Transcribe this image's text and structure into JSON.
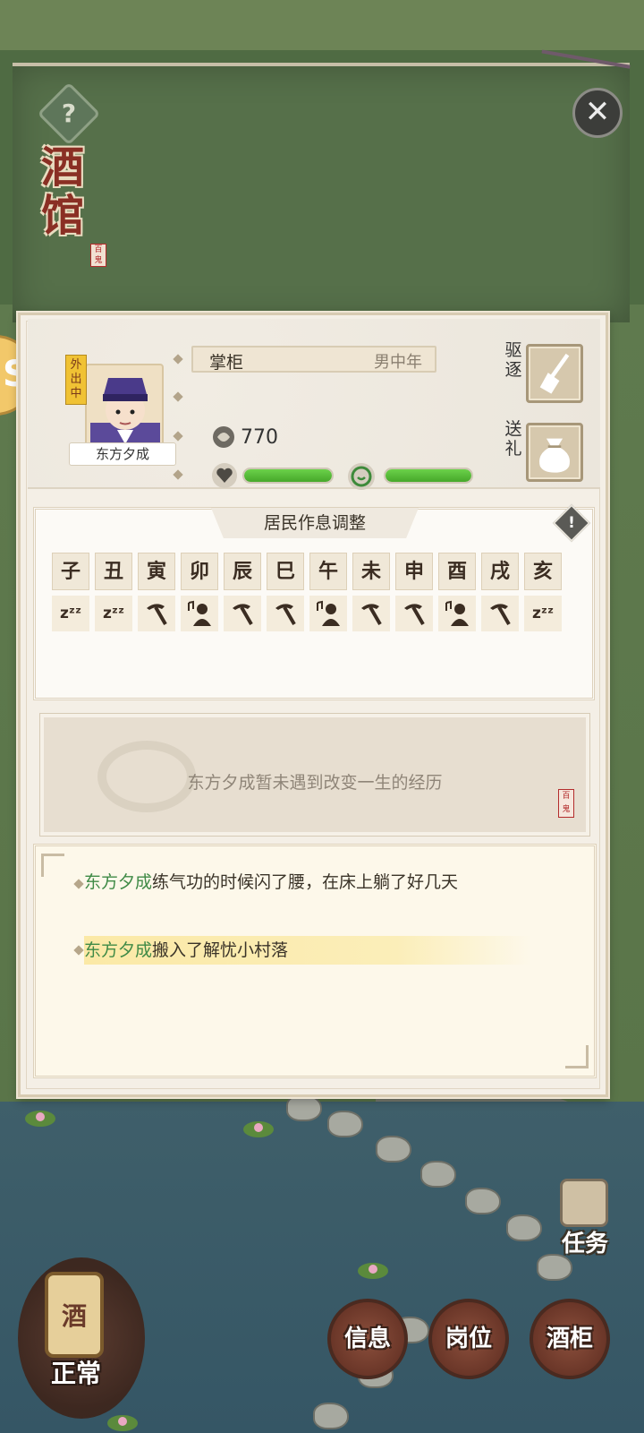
{
  "board": {
    "title": "酒馆",
    "seal": "百鬼",
    "help_icon": "?",
    "close_icon": "✕"
  },
  "resident": {
    "name": "东方夕成",
    "status_badge": "外出中",
    "role": "掌柜",
    "gender_age": "男中年",
    "coins": "770",
    "health_percent": 100,
    "mood_percent": 100
  },
  "actions": {
    "expel_label": "驱逐",
    "gift_label": "送礼"
  },
  "schedule": {
    "title": "居民作息调整",
    "info_icon": "!",
    "hours": [
      "子",
      "丑",
      "寅",
      "卯",
      "辰",
      "巳",
      "午",
      "未",
      "申",
      "酉",
      "戌",
      "亥"
    ],
    "activities": [
      "sleep",
      "sleep",
      "work",
      "leisure",
      "work",
      "work",
      "leisure",
      "work",
      "work",
      "leisure",
      "work",
      "sleep"
    ],
    "sleep_symbol": "zᶻᶻ"
  },
  "experience": {
    "text": "东方夕成暂未遇到改变一生的经历",
    "seal": "百鬼"
  },
  "log": [
    {
      "who": "东方夕成",
      "text": "练气功的时候闪了腰，在床上躺了好几天"
    },
    {
      "who": "东方夕成",
      "text": "搬入了解忧小村落"
    }
  ],
  "bottom": {
    "tasks_label": "任务",
    "info_label": "信息",
    "post_label": "岗位",
    "cabinet_label": "酒柜",
    "status_label": "正常",
    "jar_label": "酒"
  },
  "colors": {
    "accent_green": "#46a82a",
    "name_green": "#3f8a46",
    "highlight": "#fbe9a6"
  }
}
